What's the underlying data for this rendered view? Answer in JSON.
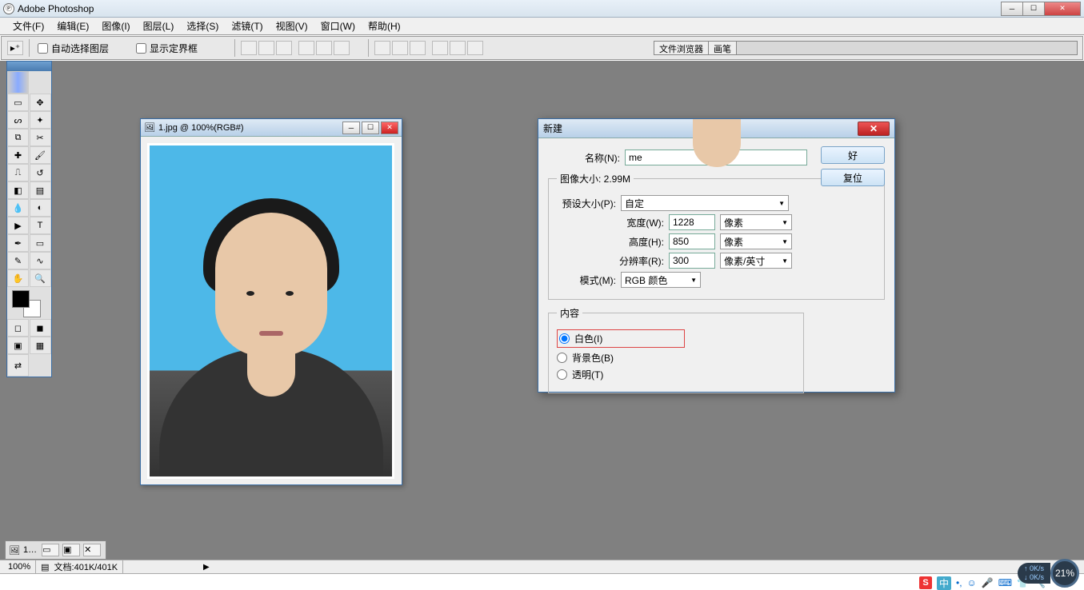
{
  "app": {
    "title": "Adobe Photoshop"
  },
  "menu": [
    "文件(F)",
    "编辑(E)",
    "图像(I)",
    "图层(L)",
    "选择(S)",
    "滤镜(T)",
    "视图(V)",
    "窗口(W)",
    "帮助(H)"
  ],
  "options": {
    "auto_select": "自动选择图层",
    "show_bounds": "显示定界框",
    "tabs": [
      "文件浏览器",
      "画笔"
    ]
  },
  "doc": {
    "title": "1.jpg @ 100%(RGB#)",
    "tab_label": "1…"
  },
  "dialog": {
    "title": "新建",
    "name_label": "名称(N):",
    "name_value": "me",
    "ok": "好",
    "reset": "复位",
    "size_legend": "图像大小: 2.99M",
    "preset_label": "预设大小(P):",
    "preset_value": "自定",
    "width_label": "宽度(W):",
    "width_value": "1228",
    "width_unit": "像素",
    "height_label": "高度(H):",
    "height_value": "850",
    "height_unit": "像素",
    "res_label": "分辨率(R):",
    "res_value": "300",
    "res_unit": "像素/英寸",
    "mode_label": "模式(M):",
    "mode_value": "RGB 颜色",
    "content_legend": "内容",
    "bg_white": "白色(I)",
    "bg_bgcolor": "背景色(B)",
    "bg_transparent": "透明(T)"
  },
  "status": {
    "zoom": "100%",
    "doc_info": "文档:401K/401K"
  },
  "tray": {
    "ime": "中",
    "net_up": "0K/s",
    "net_down": "0K/s",
    "pct": "21%"
  }
}
